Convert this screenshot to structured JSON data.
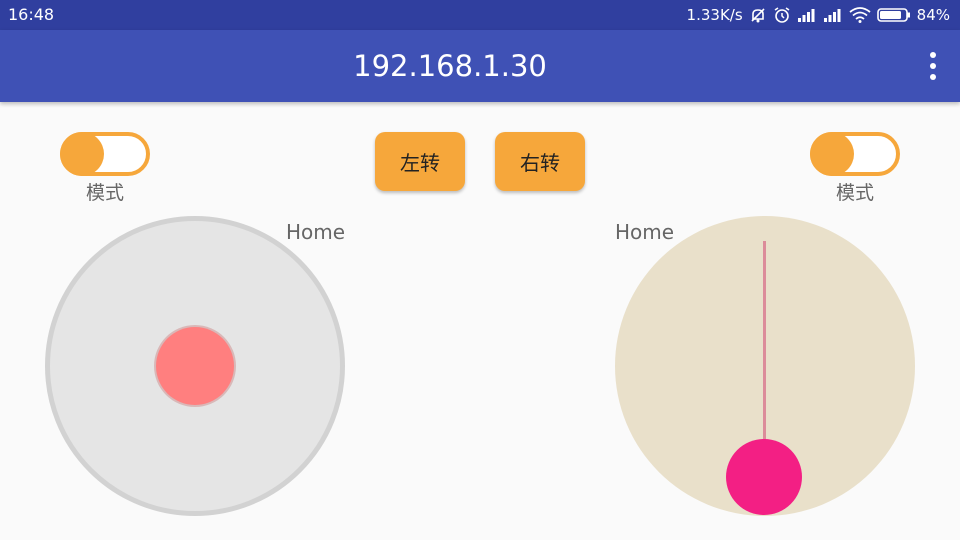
{
  "status_bar": {
    "time": "16:48",
    "net_speed": "1.33K/s",
    "battery_percent": "84%",
    "battery_level": 0.84,
    "icons": [
      "mute-icon",
      "alarm-icon",
      "signal-icon",
      "signal-icon",
      "wifi-icon",
      "battery-icon"
    ]
  },
  "app_bar": {
    "title": "192.168.1.30",
    "overflow_icon": "more-vert-icon"
  },
  "controls": {
    "left_switch": {
      "label": "模式",
      "state": "on"
    },
    "right_switch": {
      "label": "模式",
      "state": "on"
    },
    "turn_left_label": "左转",
    "turn_right_label": "右转"
  },
  "joysticks": {
    "left": {
      "home_label": "Home"
    },
    "right": {
      "home_label": "Home"
    }
  },
  "colors": {
    "status_bar": "#303f9f",
    "app_bar": "#3f51b5",
    "accent": "#f6a73b",
    "left_knob": "#ff7f7f",
    "right_knob": "#f31f84",
    "right_pad": "#e9e0ca",
    "left_pad": "#e5e5e5"
  }
}
